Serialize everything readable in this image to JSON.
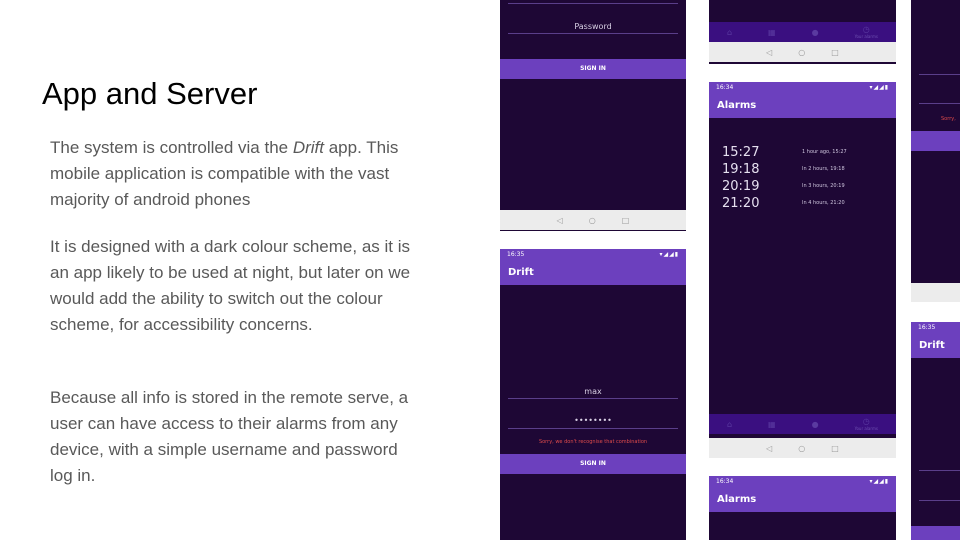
{
  "slide": {
    "title": "App and Server",
    "paragraph1": {
      "before": "The system is controlled via the ",
      "emphasis": "Drift",
      "after": " app. This mobile application is compatible with the vast majority of android phones"
    },
    "paragraph2": "It is designed with a dark colour scheme, as it is an app likely to be used at night, but later on we would add the ability to switch out the colour scheme, for accessibility concerns.",
    "paragraph3": "Because all info is stored in the remote serve, a user can have access to their alarms from any device, with a simple username and password log in."
  },
  "colors": {
    "app_background": "#1e0735",
    "app_primary": "#6c40be",
    "bottom_nav": "#3a0f80",
    "error": "#e04b4b",
    "system_nav": "#ececec"
  },
  "screens": {
    "login_top": {
      "password_placeholder": "Password",
      "signin_label": "SIGN IN"
    },
    "login_error": {
      "status_time": "16:35",
      "app_title": "Drift",
      "username_value": "max",
      "password_value": "••••••••",
      "error_message": "Sorry, we don't recognise that combination",
      "signin_label": "SIGN IN"
    },
    "alarms_top": {
      "bottom_nav_label": "Your alarms"
    },
    "alarms_list": {
      "status_time": "16:34",
      "app_title": "Alarms",
      "alarms": [
        {
          "time": "15:27",
          "relative": "1 hour ago, 15:27"
        },
        {
          "time": "19:18",
          "relative": "In 2 hours, 19:18"
        },
        {
          "time": "20:19",
          "relative": "In 3 hours, 20:19"
        },
        {
          "time": "21:20",
          "relative": "In 4 hours, 21:20"
        }
      ],
      "bottom_nav_label": "Your alarms"
    },
    "alarms_bottom": {
      "status_time": "16:34",
      "app_title": "Alarms"
    },
    "right_top": {
      "error_fragment": "Sorry,"
    },
    "right_bottom": {
      "status_time": "16:35",
      "app_title": "Drift"
    }
  },
  "icons": {
    "status": "wifi-signal-battery-icons",
    "nav_back": "back-triangle-icon",
    "nav_home": "home-circle-icon",
    "nav_recent": "recent-square-icon",
    "bottom_home": "home-icon",
    "bottom_grid": "grid-icon",
    "bottom_bulb": "bulb-icon",
    "bottom_alarm": "alarm-clock-icon"
  }
}
